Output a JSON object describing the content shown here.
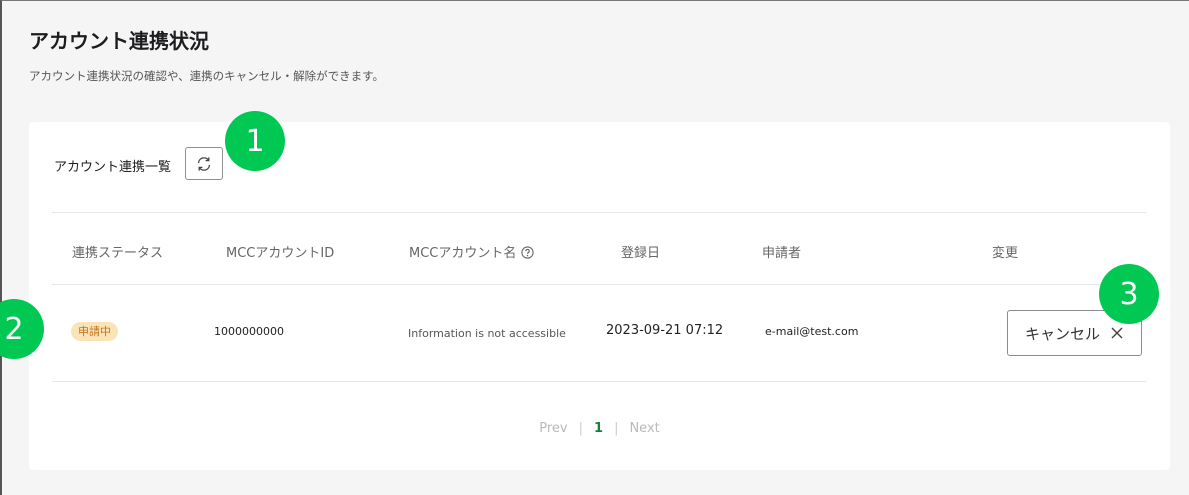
{
  "page": {
    "title": "アカウント連携状況",
    "subtitle": "アカウント連携状況の確認や、連携のキャンセル・解除ができます。"
  },
  "card": {
    "list_title": "アカウント連携一覧",
    "refresh_icon": "refresh-icon"
  },
  "table": {
    "headers": [
      "連携ステータス",
      "MCCアカウントID",
      "MCCアカウント名",
      "登録日",
      "申請者",
      "変更"
    ],
    "help_icon": "question-circle-icon",
    "rows": [
      {
        "status": "申請中",
        "mcc_id": "1000000000",
        "mcc_name": "Information is not accessible",
        "registered": "2023-09-21 07:12",
        "applicant": "e-mail@test.com",
        "action_label": "キャンセル"
      }
    ]
  },
  "pagination": {
    "prev": "Prev",
    "current": "1",
    "next": "Next"
  },
  "markers": [
    "1",
    "2",
    "3"
  ],
  "colors": {
    "marker": "#00c853",
    "badge_bg": "#fbe3b8",
    "badge_text": "#c4741a",
    "current_page": "#14823c"
  }
}
